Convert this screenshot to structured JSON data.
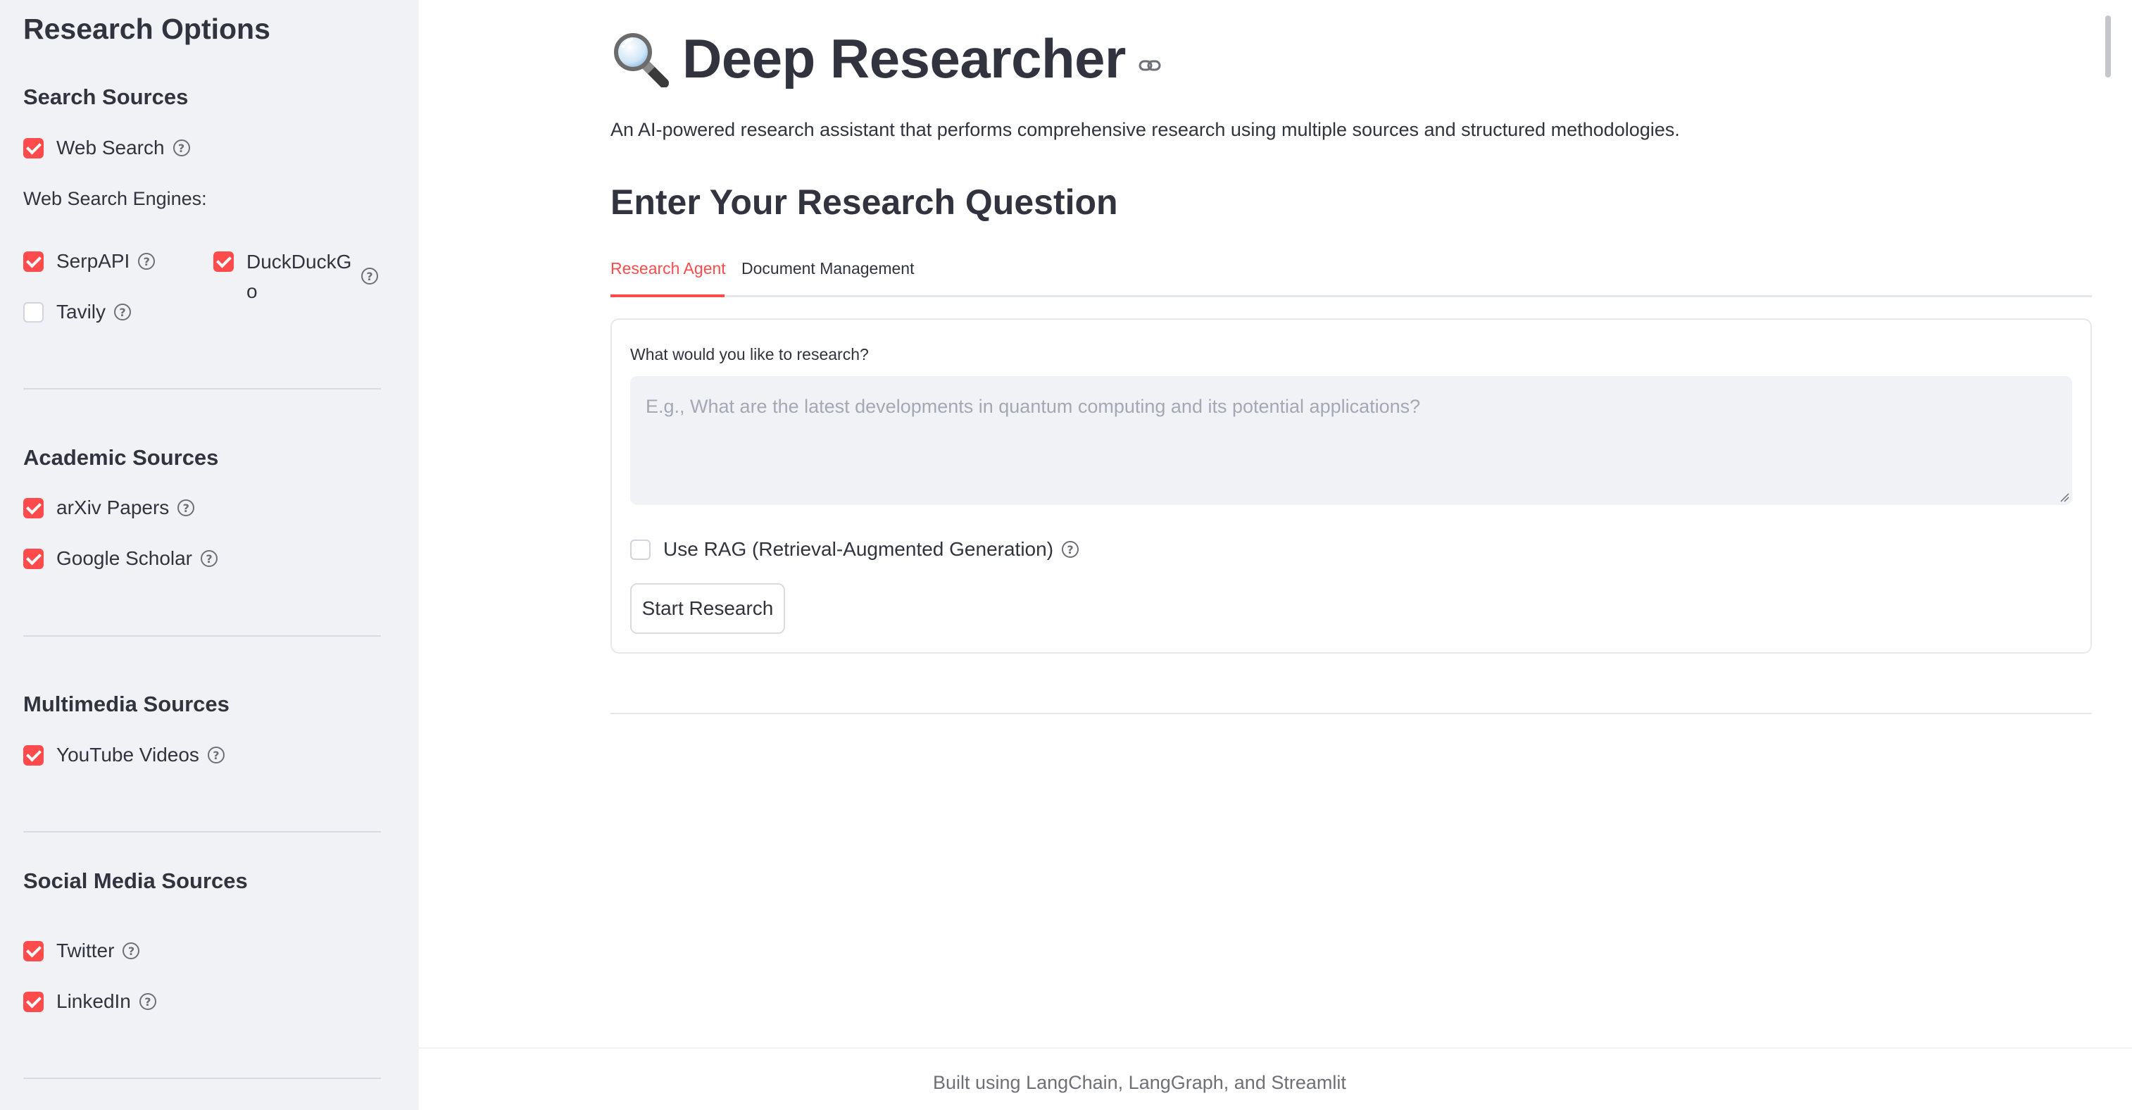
{
  "sidebar": {
    "title": "Research Options",
    "search_sources": {
      "heading": "Search Sources",
      "web_search": {
        "label": "Web Search",
        "checked": true
      },
      "engines_label": "Web Search Engines:",
      "serpapi": {
        "label": "SerpAPI",
        "checked": true
      },
      "duckduckgo": {
        "label_line1": "DuckDuckG",
        "label_line2": "o",
        "checked": true
      },
      "tavily": {
        "label": "Tavily",
        "checked": false
      }
    },
    "academic_sources": {
      "heading": "Academic Sources",
      "arxiv": {
        "label": "arXiv Papers",
        "checked": true
      },
      "scholar": {
        "label": "Google Scholar",
        "checked": true
      }
    },
    "multimedia_sources": {
      "heading": "Multimedia Sources",
      "youtube": {
        "label": "YouTube Videos",
        "checked": true
      }
    },
    "social_sources": {
      "heading": "Social Media Sources",
      "twitter": {
        "label": "Twitter",
        "checked": true
      },
      "linkedin": {
        "label": "LinkedIn",
        "checked": true
      }
    }
  },
  "main": {
    "title": "Deep Researcher",
    "title_icon": "magnifying-glass-icon",
    "subtitle": "An AI-powered research assistant that performs comprehensive research using multiple sources and structured methodologies.",
    "section_heading": "Enter Your Research Question",
    "tabs": [
      {
        "label": "Research Agent",
        "active": true
      },
      {
        "label": "Document Management",
        "active": false
      }
    ],
    "form": {
      "question_label": "What would you like to research?",
      "question_value": "",
      "question_placeholder": "E.g., What are the latest developments in quantum computing and its potential applications?",
      "rag": {
        "label": "Use RAG (Retrieval-Augmented Generation)",
        "checked": false
      },
      "submit_label": "Start Research"
    },
    "footer": "Built using LangChain, LangGraph, and Streamlit"
  },
  "colors": {
    "accent": "#ff4b4b",
    "sidebar_bg": "#f0f2f6",
    "text": "#31333f",
    "placeholder": "#a3a8b4"
  }
}
